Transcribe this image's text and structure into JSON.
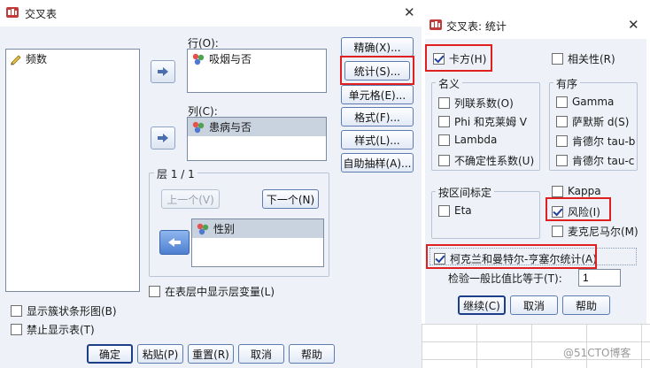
{
  "main": {
    "title": "交叉表",
    "source_list": [
      {
        "label": "频数"
      }
    ],
    "rows_label": "行(O):",
    "rows_items": [
      {
        "label": "吸烟与否"
      }
    ],
    "cols_label": "列(C):",
    "cols_items": [
      {
        "label": "患病与否"
      }
    ],
    "layer_title": "层 1 / 1",
    "prev_button": "上一个(V)",
    "next_button": "下一个(N)",
    "layer_items": [
      {
        "label": "性别"
      }
    ],
    "show_layer_checkbox": {
      "label": "在表层中显示层变量(L)",
      "checked": false
    },
    "show_bar_checkbox": {
      "label": "显示簇状条形图(B)",
      "checked": false
    },
    "suppress_tables_checkbox": {
      "label": "禁止显示表(T)",
      "checked": false
    },
    "side_buttons": [
      "精确(X)...",
      "统计(S)...",
      "单元格(E)...",
      "格式(F)...",
      "样式(L)...",
      "自助抽样(A)..."
    ],
    "bottom_buttons": [
      "确定",
      "粘贴(P)",
      "重置(R)",
      "取消",
      "帮助"
    ]
  },
  "stats": {
    "title": "交叉表: 统计",
    "chi_square": {
      "label": "卡方(H)",
      "checked": true
    },
    "correlations": {
      "label": "相关性(R)",
      "checked": false
    },
    "nominal": {
      "title": "名义",
      "items": [
        {
          "label": "列联系数(O)",
          "checked": false
        },
        {
          "label": "Phi 和克莱姆 V",
          "checked": false
        },
        {
          "label": "Lambda",
          "checked": false
        },
        {
          "label": "不确定性系数(U)",
          "checked": false
        }
      ]
    },
    "ordinal": {
      "title": "有序",
      "items": [
        {
          "label": "Gamma",
          "checked": false
        },
        {
          "label": "萨默斯 d(S)",
          "checked": false
        },
        {
          "label": "肯德尔 tau-b",
          "checked": false
        },
        {
          "label": "肯德尔 tau-c",
          "checked": false
        }
      ]
    },
    "interval": {
      "title": "按区间标定",
      "items": [
        {
          "label": "Eta",
          "checked": false
        }
      ]
    },
    "kappa": {
      "label": "Kappa",
      "checked": false
    },
    "risk": {
      "label": "风险(I)",
      "checked": true
    },
    "mcnemar": {
      "label": "麦克尼马尔(M)",
      "checked": false
    },
    "cmh": {
      "label": "柯克兰和曼特尔-亨塞尔统计(A)",
      "checked": true
    },
    "test_ratio_label": "检验一般比值比等于(T):",
    "test_ratio_value": "1",
    "buttons": [
      "继续(C)",
      "取消",
      "帮助"
    ]
  },
  "watermark": "@51CTO博客",
  "colors": {
    "highlight_frame": "#e02020",
    "dialog_bg": "#eef2f8",
    "button_border": "#5b7bb1"
  }
}
